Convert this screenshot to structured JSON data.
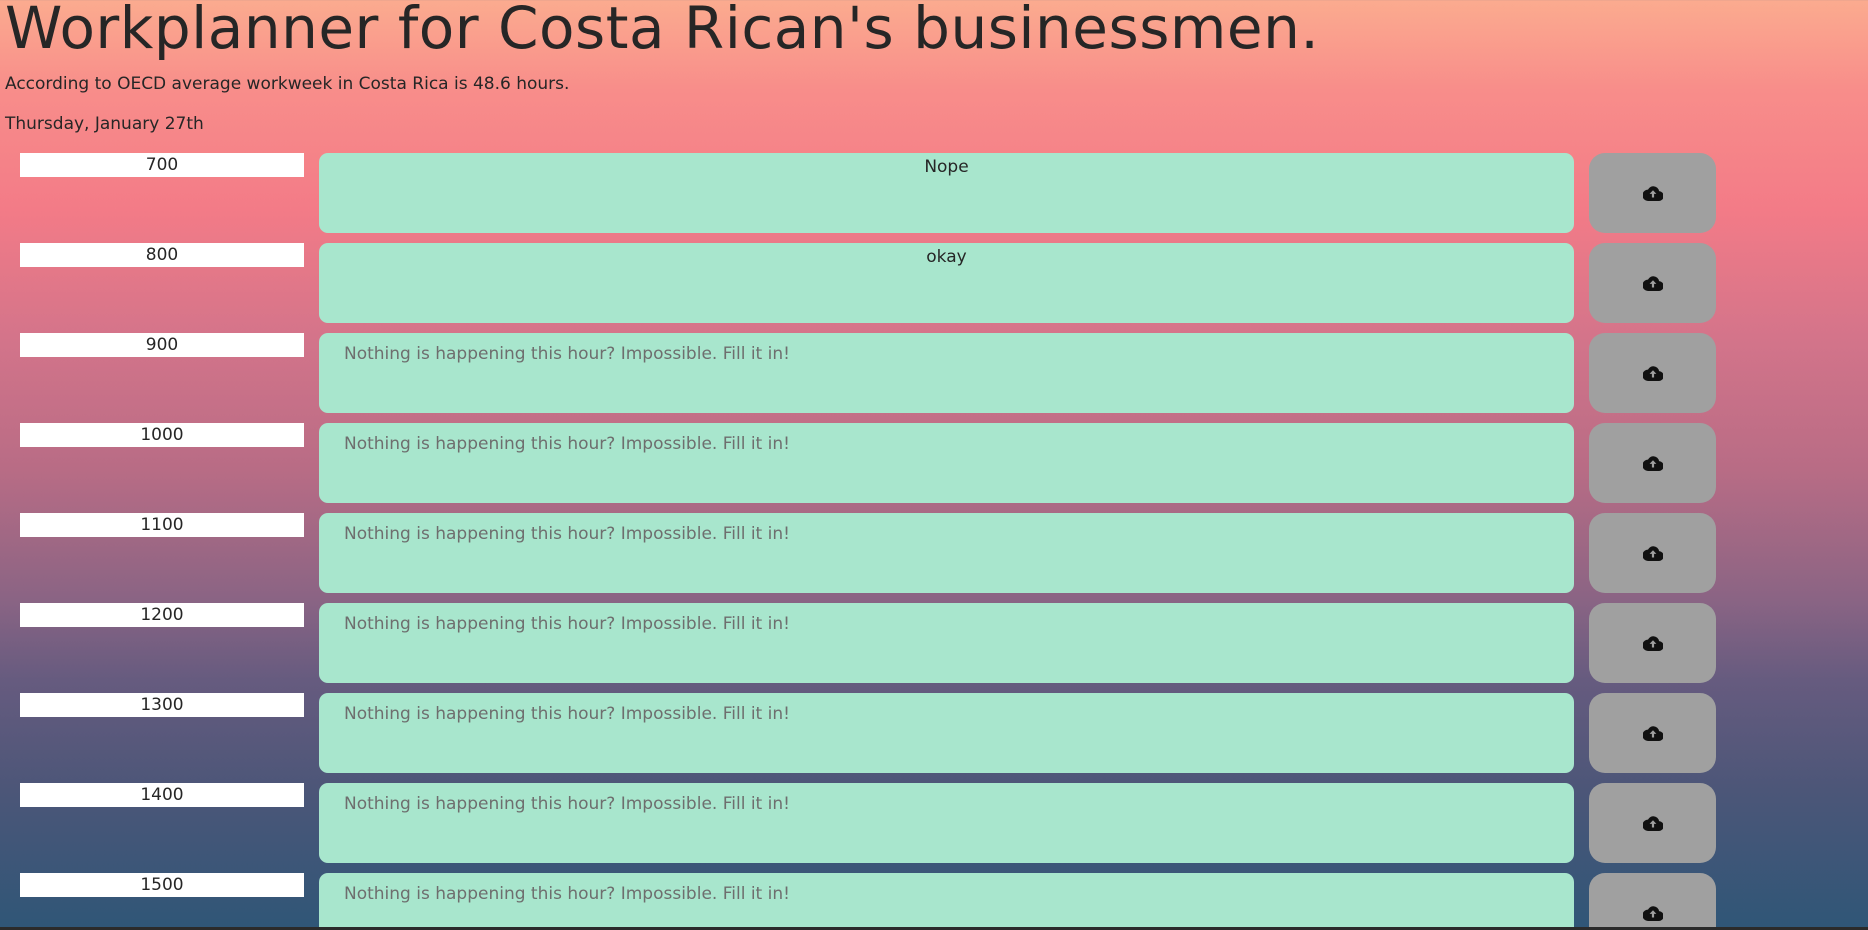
{
  "header": {
    "title": "Workplanner for Costa Rican's businessmen.",
    "subtitle": "According to OECD average workweek in Costa Rica is 48.6 hours.",
    "date": "Thursday, January 27th"
  },
  "colors": {
    "description_bg": "#a8e6cd",
    "save_button_bg": "#a0a0a0",
    "hour_bg": "#ffffff"
  },
  "save_icon": "cloud-upload-icon",
  "rows": [
    {
      "hour": "700",
      "text": "Nope",
      "placeholder": "Nothing is happening this hour? Impossible. Fill it in!"
    },
    {
      "hour": "800",
      "text": "okay",
      "placeholder": "Nothing is happening this hour? Impossible. Fill it in!"
    },
    {
      "hour": "900",
      "text": "",
      "placeholder": "Nothing is happening this hour? Impossible. Fill it in!"
    },
    {
      "hour": "1000",
      "text": "",
      "placeholder": "Nothing is happening this hour? Impossible. Fill it in!"
    },
    {
      "hour": "1100",
      "text": "",
      "placeholder": "Nothing is happening this hour? Impossible. Fill it in!"
    },
    {
      "hour": "1200",
      "text": "",
      "placeholder": "Nothing is happening this hour? Impossible. Fill it in!"
    },
    {
      "hour": "1300",
      "text": "",
      "placeholder": "Nothing is happening this hour? Impossible. Fill it in!"
    },
    {
      "hour": "1400",
      "text": "",
      "placeholder": "Nothing is happening this hour? Impossible. Fill it in!"
    },
    {
      "hour": "1500",
      "text": "",
      "placeholder": "Nothing is happening this hour? Impossible. Fill it in!"
    }
  ]
}
